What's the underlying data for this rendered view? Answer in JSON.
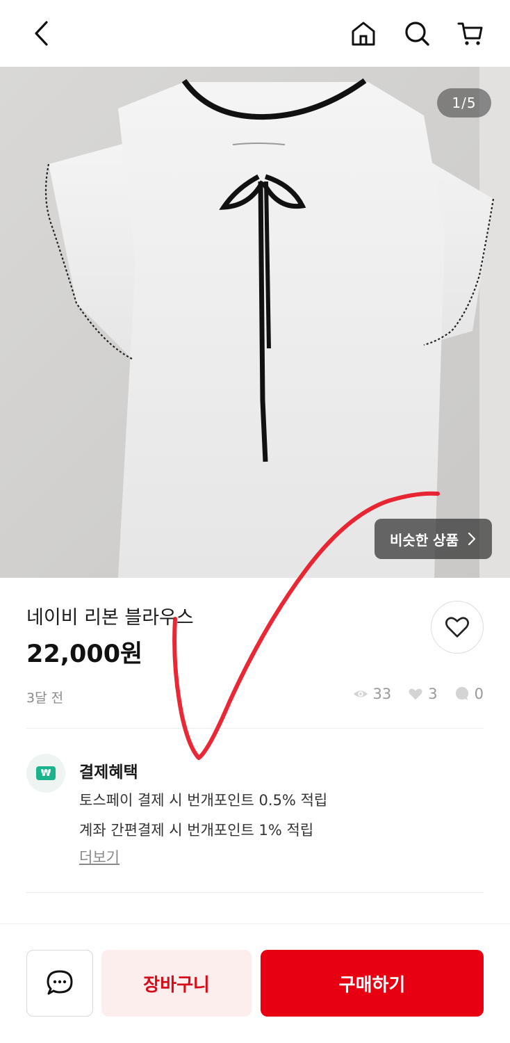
{
  "header": {
    "back_icon": "chevron-left-icon",
    "home_icon": "home-icon",
    "search_icon": "search-icon",
    "cart_icon": "cart-icon"
  },
  "gallery": {
    "counter": "1/5",
    "similar_label": "비슷한 상품"
  },
  "product": {
    "title": "네이비 리본 블라우스",
    "price": "22,000원",
    "posted": "3달 전",
    "views": "33",
    "likes": "3",
    "comments": "0"
  },
  "benefits": {
    "title": "결제혜택",
    "icon_text": "₩",
    "lines": [
      "토스페이 결제 시 번개포인트 0.5% 적립",
      "계좌 간편결제 시 번개포인트 1% 적립"
    ],
    "more": "더보기"
  },
  "bottom": {
    "cart_label": "장바구니",
    "buy_label": "구매하기"
  },
  "colors": {
    "accent": "#e60012",
    "cart_bg": "#fdeeee",
    "benefit_green": "#1bb38c"
  }
}
